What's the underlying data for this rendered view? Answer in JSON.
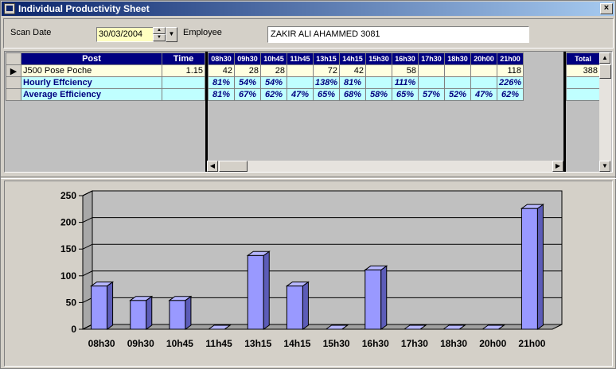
{
  "window": {
    "title": "Individual Productivity Sheet",
    "close_glyph": "×"
  },
  "toolbar": {
    "scan_date_label": "Scan Date",
    "scan_date_value": "30/03/2004",
    "employee_label": "Employee",
    "employee_value": "ZAKIR ALI AHAMMED 3081"
  },
  "grid": {
    "post_header": "Post",
    "time_header": "Time",
    "total_header": "Total",
    "hours": [
      "08h30",
      "09h30",
      "10h45",
      "11h45",
      "13h15",
      "14h15",
      "15h30",
      "16h30",
      "17h30",
      "18h30",
      "20h00",
      "21h00"
    ],
    "rows": [
      {
        "post": "J500 Pose Poche",
        "time": "1.15",
        "values": [
          "42",
          "28",
          "28",
          "",
          "72",
          "42",
          "",
          "58",
          "",
          "",
          "",
          "118"
        ],
        "total": "388"
      },
      {
        "post": "Hourly Effciency",
        "time": "",
        "values": [
          "81%",
          "54%",
          "54%",
          "",
          "138%",
          "81%",
          "",
          "111%",
          "",
          "",
          "",
          "226%"
        ],
        "total": ""
      },
      {
        "post": "Average Efficiency",
        "time": "",
        "values": [
          "81%",
          "67%",
          "62%",
          "47%",
          "65%",
          "68%",
          "58%",
          "65%",
          "57%",
          "52%",
          "47%",
          "62%"
        ],
        "total": ""
      }
    ]
  },
  "chart_data": {
    "type": "bar",
    "categories": [
      "08h30",
      "09h30",
      "10h45",
      "11h45",
      "13h15",
      "14h15",
      "15h30",
      "16h30",
      "17h30",
      "18h30",
      "20h00",
      "21h00"
    ],
    "values": [
      81,
      54,
      54,
      0,
      138,
      81,
      0,
      111,
      0,
      0,
      0,
      226
    ],
    "ylim": [
      0,
      250
    ],
    "yticks": [
      "0",
      "50",
      "100",
      "150",
      "200",
      "250"
    ],
    "grid": true,
    "colors": {
      "bar_front": "#9999ff",
      "bar_side": "#5c5cb8",
      "bar_top": "#b8b8ff",
      "wall": "#c0c0c0",
      "floor": "#a0a0a0"
    }
  }
}
